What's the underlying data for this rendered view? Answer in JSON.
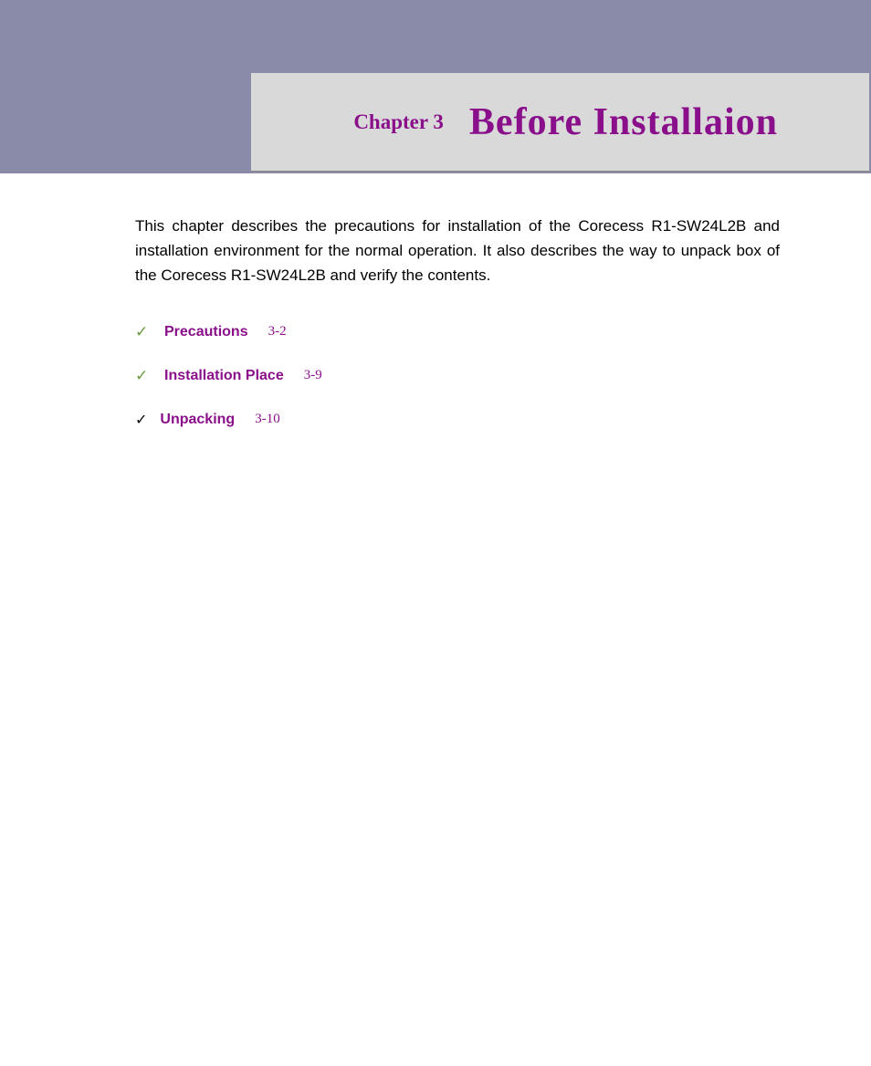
{
  "header": {
    "chapter_label": "Chapter 3",
    "chapter_title": "Before Installaion"
  },
  "intro": "This chapter describes the precautions for installation of the Corecess R1-SW24L2B and installation environment for the normal operation. It also describes the way to unpack box of the Corecess R1-SW24L2B and verify the contents.",
  "toc": [
    {
      "label": "Precautions",
      "page": "3-2"
    },
    {
      "label": "Installation Place",
      "page": "3-9"
    },
    {
      "label": "Unpacking",
      "page": "3-10"
    }
  ],
  "colors": {
    "header_bg": "#8a8ba9",
    "title_bg": "#d9d9d9",
    "accent": "#8a0f8a",
    "check": "#6b9b3e"
  }
}
